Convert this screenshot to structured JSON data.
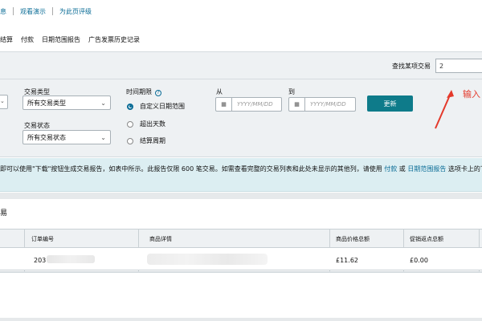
{
  "top_links": {
    "item1": "息",
    "item2": "观看演示",
    "item3": "为此页评级"
  },
  "subnav": {
    "items": [
      "结算",
      "付款",
      "日期范围报告",
      "广告发票历史记录"
    ]
  },
  "filters": {
    "find_transaction_label": "查找某项交易",
    "find_transaction_value": "2",
    "transaction_type_label": "交易类型",
    "transaction_type_value": "所有交易类型",
    "transaction_status_label": "交易状态",
    "transaction_status_value": "所有交易状态",
    "time_period_label": "时间期限",
    "time_options": [
      "自定义日期范围",
      "超出天数",
      "结算周期"
    ],
    "from_label": "从",
    "to_label": "到",
    "date_placeholder": "YYYY/MM/DD",
    "update_button": "更新"
  },
  "annotation": {
    "text": "输入"
  },
  "banner": {
    "text_part1": "即可以使用\"下载\"按钮生成交易报告，如表中所示。此报告仅限 600 笔交易。如需查看完整的交易列表和此处未显示的其他列，请使用 ",
    "link1": "付款",
    "text_mid": " 或 ",
    "link2": "日期范围报告",
    "text_part2": " 选项卡上的下"
  },
  "section": {
    "title": "易"
  },
  "table": {
    "headers": [
      "订单编号",
      "商品详情",
      "商品价格总额",
      "促销返点总额"
    ],
    "row": {
      "col0": "",
      "order_id": "203",
      "price_total": "£11.62",
      "promo_total": "£0.00"
    }
  },
  "colors": {
    "link": "#0a6c96",
    "button": "#0e7b8a",
    "annotation": "#e4392b"
  }
}
